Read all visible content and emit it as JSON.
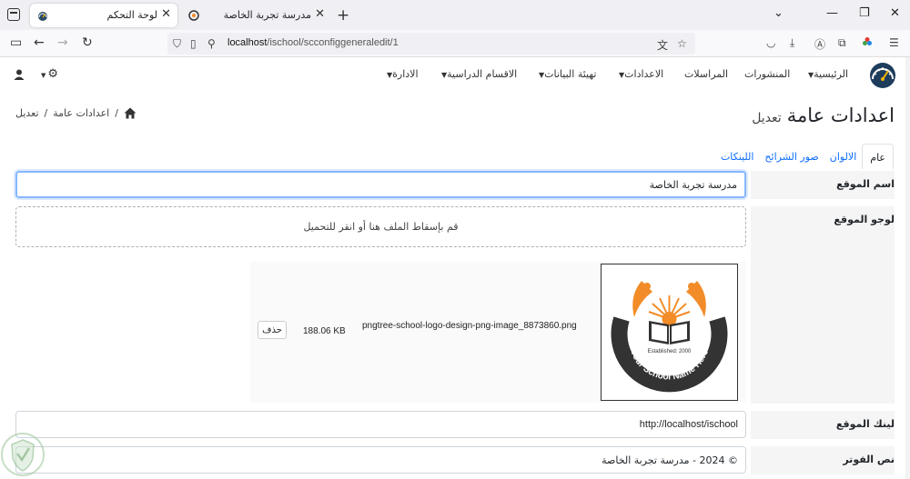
{
  "browser": {
    "tabs": [
      {
        "title": "لوحة التحكم",
        "active": true
      },
      {
        "title": "مدرسة تجربة الخاصة",
        "active": false
      }
    ],
    "url_host": "localhost",
    "url_path": "/ischool/scconfiggeneraledit/1"
  },
  "nav": {
    "menu": [
      {
        "label": "الرئيسية",
        "dropdown": true
      },
      {
        "label": "المنشورات",
        "dropdown": false
      },
      {
        "label": "المراسلات",
        "dropdown": false
      },
      {
        "label": "الاعدادات",
        "dropdown": true
      },
      {
        "label": "تهيئة البيانات",
        "dropdown": true
      },
      {
        "label": "الاقسام الدراسية",
        "dropdown": true
      },
      {
        "label": "الادارة",
        "dropdown": true
      }
    ]
  },
  "page": {
    "title": "اعدادات عامة",
    "subtitle": "تعديل",
    "breadcrumb": [
      "اعدادات عامة",
      "تعديل"
    ]
  },
  "tabs": [
    {
      "label": "عام",
      "active": true
    },
    {
      "label": "الالوان",
      "active": false
    },
    {
      "label": "صور الشرائح",
      "active": false
    },
    {
      "label": "اللينكات",
      "active": false
    }
  ],
  "form": {
    "site_name_label": "اسم الموقع",
    "site_name_value": "مدرسة تجربة الخاصة",
    "site_logo_label": "لوجو الموقع",
    "dropzone_text": "قم بإسقاط الملف هنا أو انقر للتحميل",
    "file_name": "pngtree-school-logo-design-png-image_8873860.png",
    "file_size": "188.06 KB",
    "delete_label": "حذف",
    "site_link_label": "لينك الموقع",
    "site_link_value": "http://localhost/ischool",
    "footer_label": "نص الفوتر",
    "footer_value": "© 2024 - مدرسة تجربة الخاصة"
  },
  "logo_image": {
    "established": "Established: 2000",
    "ring_text": "Your School Name Here"
  },
  "colors": {
    "accent": "#0d6efd",
    "focus_border": "#86b7fe",
    "label_bg": "#f5f5f5",
    "logo_orange": "#f28c28",
    "logo_dark": "#333333"
  }
}
